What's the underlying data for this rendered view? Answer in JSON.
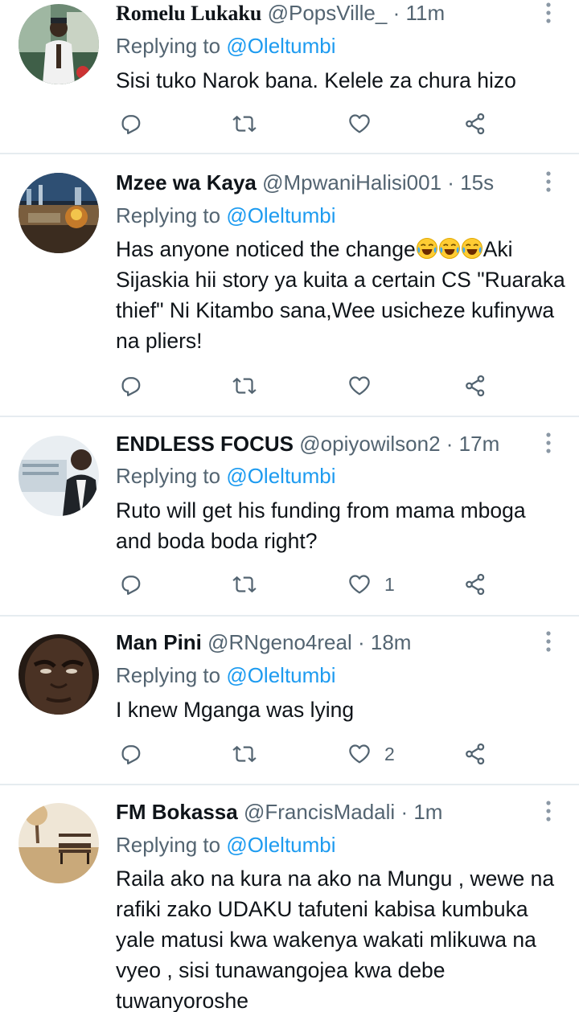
{
  "tweets": [
    {
      "name": "Romelu Lukaku",
      "handle": "@PopsVille_",
      "sep": "·",
      "time": "11m",
      "replying_prefix": "Replying to ",
      "replying_to": "@Oleltumbi",
      "text": "Sisi tuko Narok bana. Kelele za chura hizo",
      "likes": ""
    },
    {
      "name": "Mzee wa Kaya",
      "handle": "@MpwaniHalisi001",
      "sep": "·",
      "time": "15s",
      "replying_prefix": "Replying to ",
      "replying_to": "@Oleltumbi",
      "text_before_emoji": "Has anyone noticed the change",
      "emoji": "😂😂😂",
      "text_after_emoji": "Aki Sijaskia hii story ya kuita a certain CS \"Ruaraka thief\" Ni Kitambo sana,Wee usicheze kufinywa na pliers!",
      "likes": ""
    },
    {
      "name": "ENDLESS FOCUS",
      "handle": "@opiyowilson2",
      "sep": "·",
      "time": "17m",
      "replying_prefix": "Replying to ",
      "replying_to": "@Oleltumbi",
      "text": "Ruto will get his funding from mama mboga and boda boda right?",
      "likes": "1"
    },
    {
      "name": "Man Pini",
      "handle": "@RNgeno4real",
      "sep": "·",
      "time": "18m",
      "replying_prefix": "Replying to ",
      "replying_to": "@Oleltumbi",
      "text": "I knew Mganga was lying",
      "likes": "2"
    },
    {
      "name": "FM Bokassa",
      "handle": "@FrancisMadali",
      "sep": "·",
      "time": "1m",
      "replying_prefix": "Replying to ",
      "replying_to": "@Oleltumbi",
      "text": "Raila ako na kura na ako na Mungu , wewe na rafiki zako UDAKU tafuteni kabisa kumbuka yale matusi kwa wakenya wakati mlikuwa na vyeo , sisi tunawangojea kwa debe tuwanyoroshe",
      "likes": ""
    }
  ],
  "icons": {
    "reply": "comment-icon",
    "retweet": "retweet-icon",
    "like": "heart-icon",
    "share": "share-icon",
    "more": "more-vertical-icon"
  },
  "colors": {
    "text": "#0f1419",
    "secondary": "#536471",
    "accent": "#1d9bf0",
    "divider": "#e6ecf0"
  }
}
